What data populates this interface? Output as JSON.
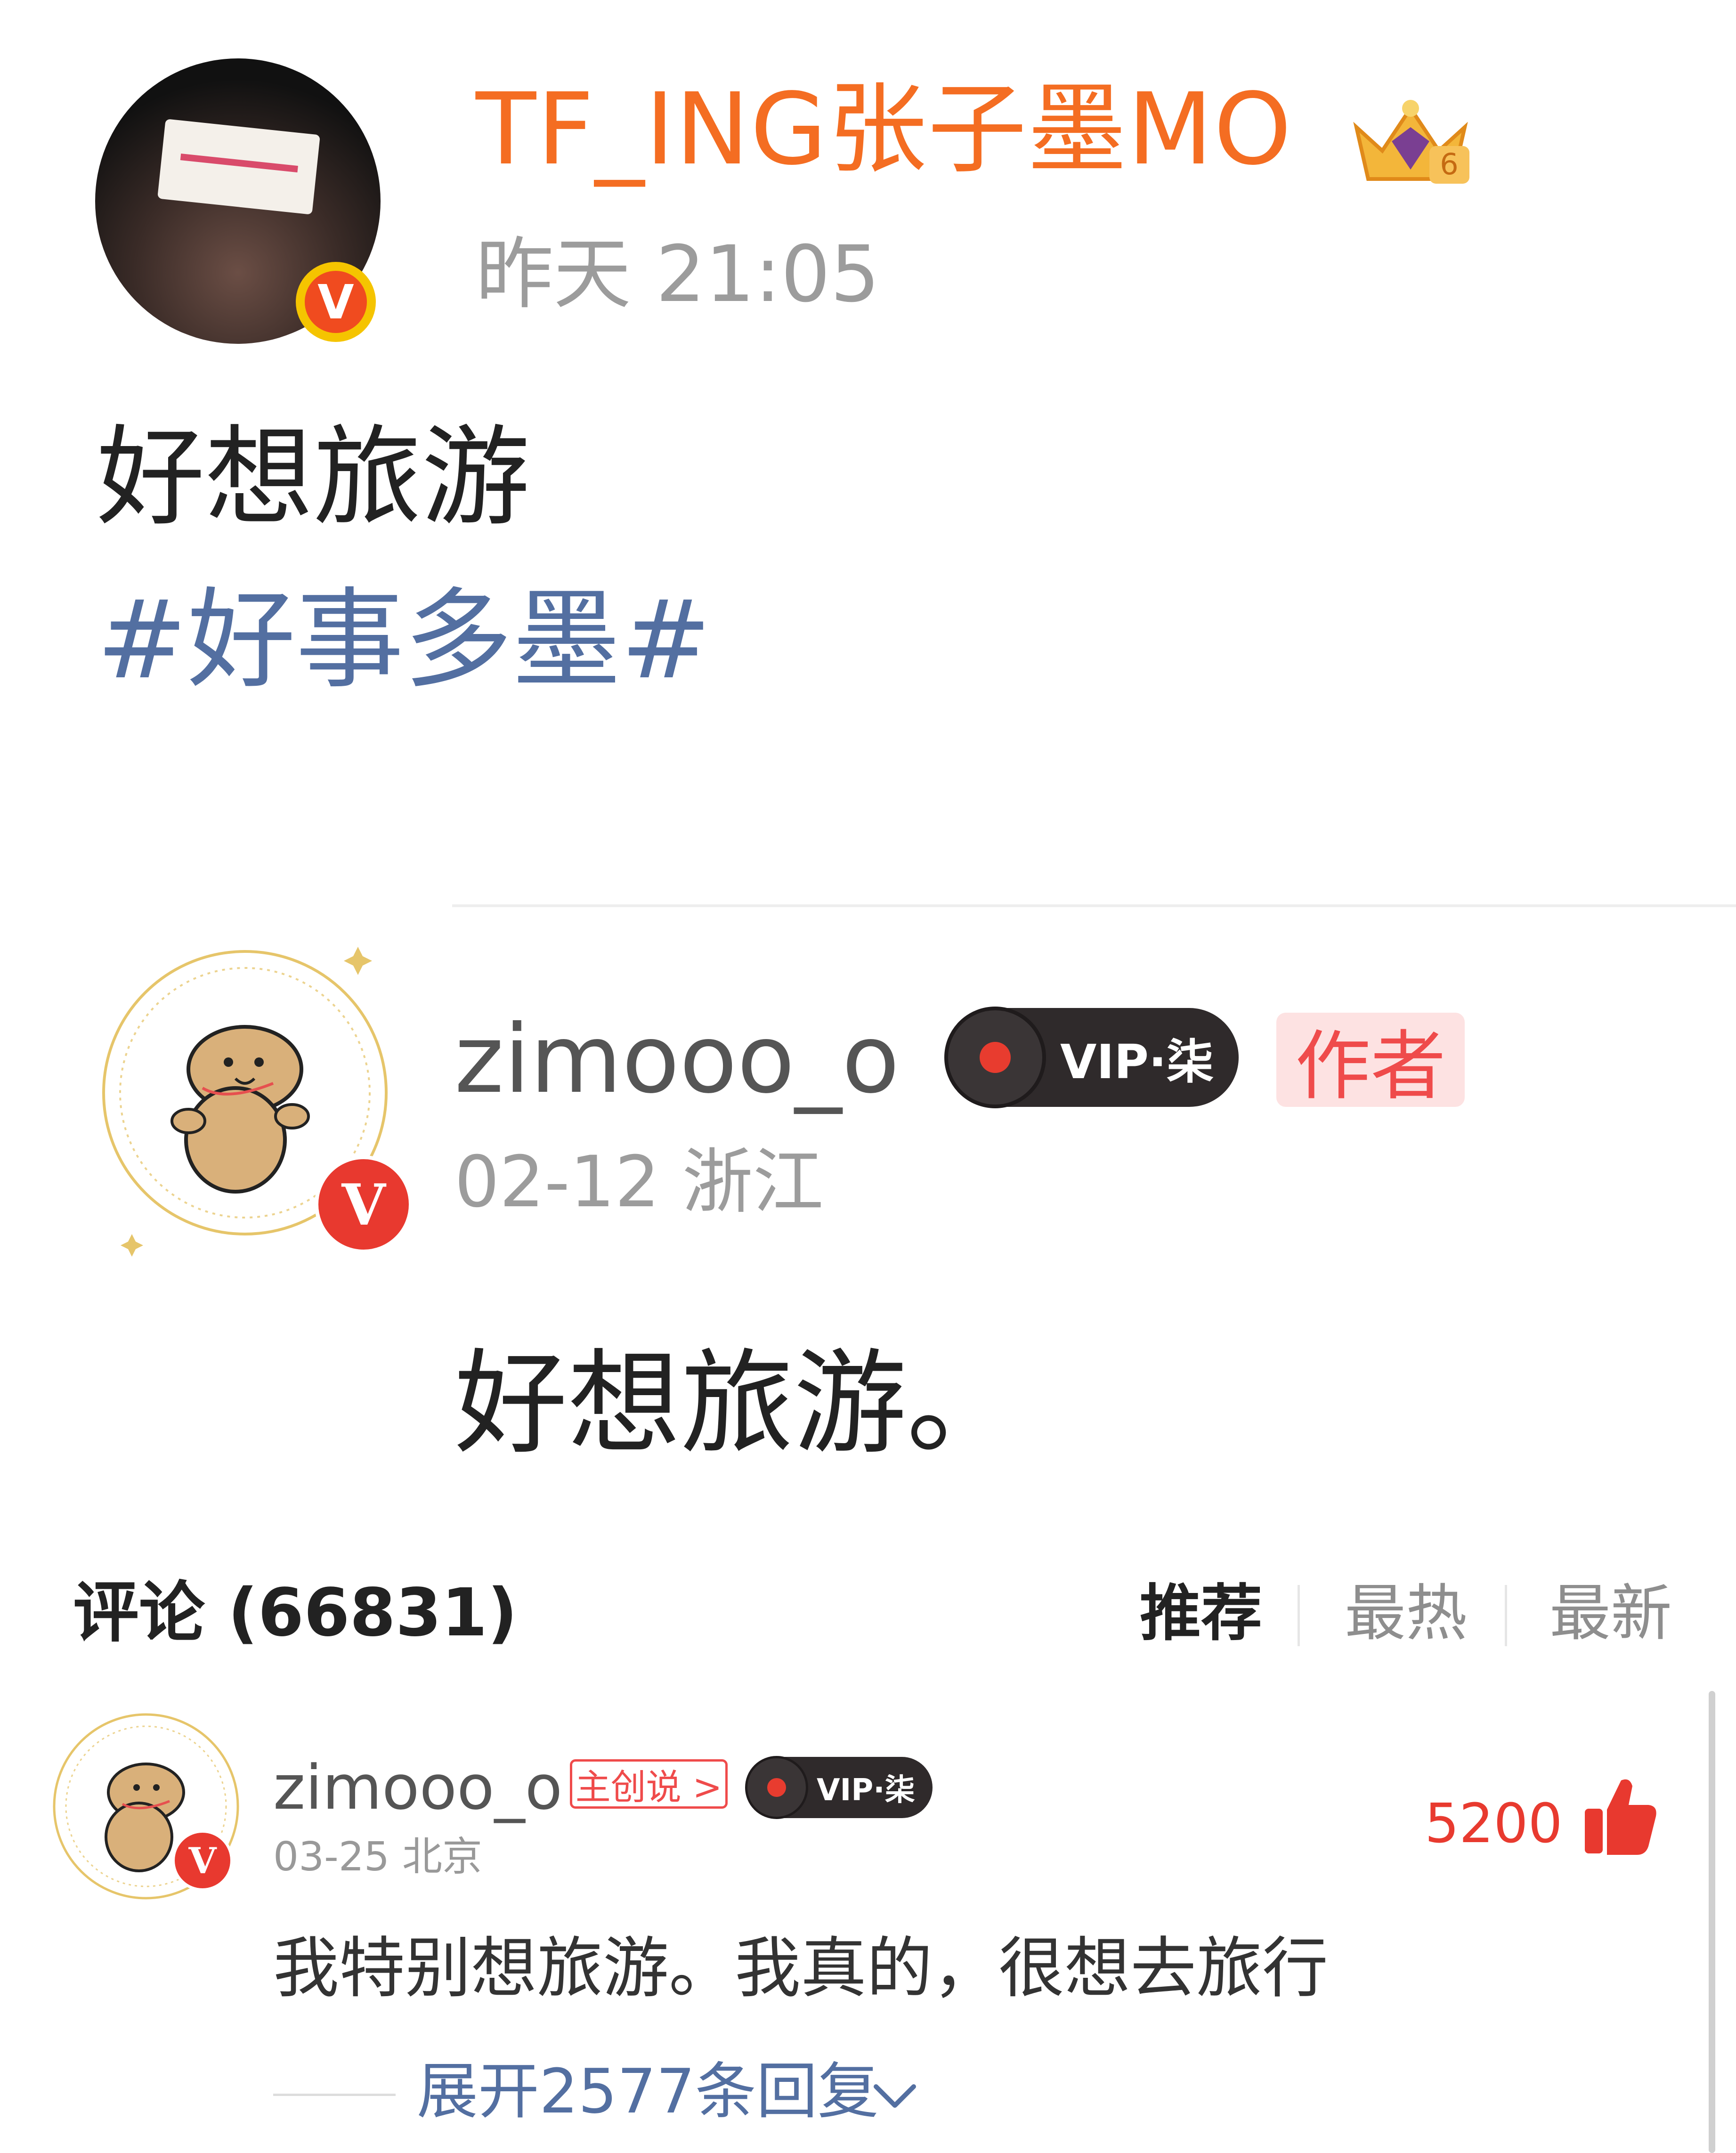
{
  "post": {
    "author_name": "TF_ING张子墨MO",
    "time": "昨天 21:05",
    "text": "好想旅游",
    "topic": "#好事多墨#",
    "avatar_badge": "V",
    "crown_level": "6",
    "crown_icon": "crown-icon"
  },
  "quoted": {
    "name": "zimooo_o",
    "vip_label": "VIP·柒",
    "author_tag": "作者",
    "meta": "02-12 浙江",
    "text": "好想旅游。",
    "avatar_badge": "V"
  },
  "comments_header": {
    "title": "评论 (66831)",
    "tabs": [
      "推荐",
      "最热",
      "最新"
    ],
    "active_tab": "推荐"
  },
  "comment": {
    "name": "zimooo_o",
    "creator_tag": "主创说 >",
    "vip_label": "VIP·柒",
    "meta": "03-25 北京",
    "likes": "5200",
    "text": "我特别想旅游。我真的，很想去旅行",
    "expand_replies": "展开2577条回复",
    "avatar_badge": "V"
  },
  "colors": {
    "accent_orange": "#f46d22",
    "topic_blue": "#536fa1",
    "like_red": "#e83a2f",
    "tag_red": "#ef4b4b"
  }
}
